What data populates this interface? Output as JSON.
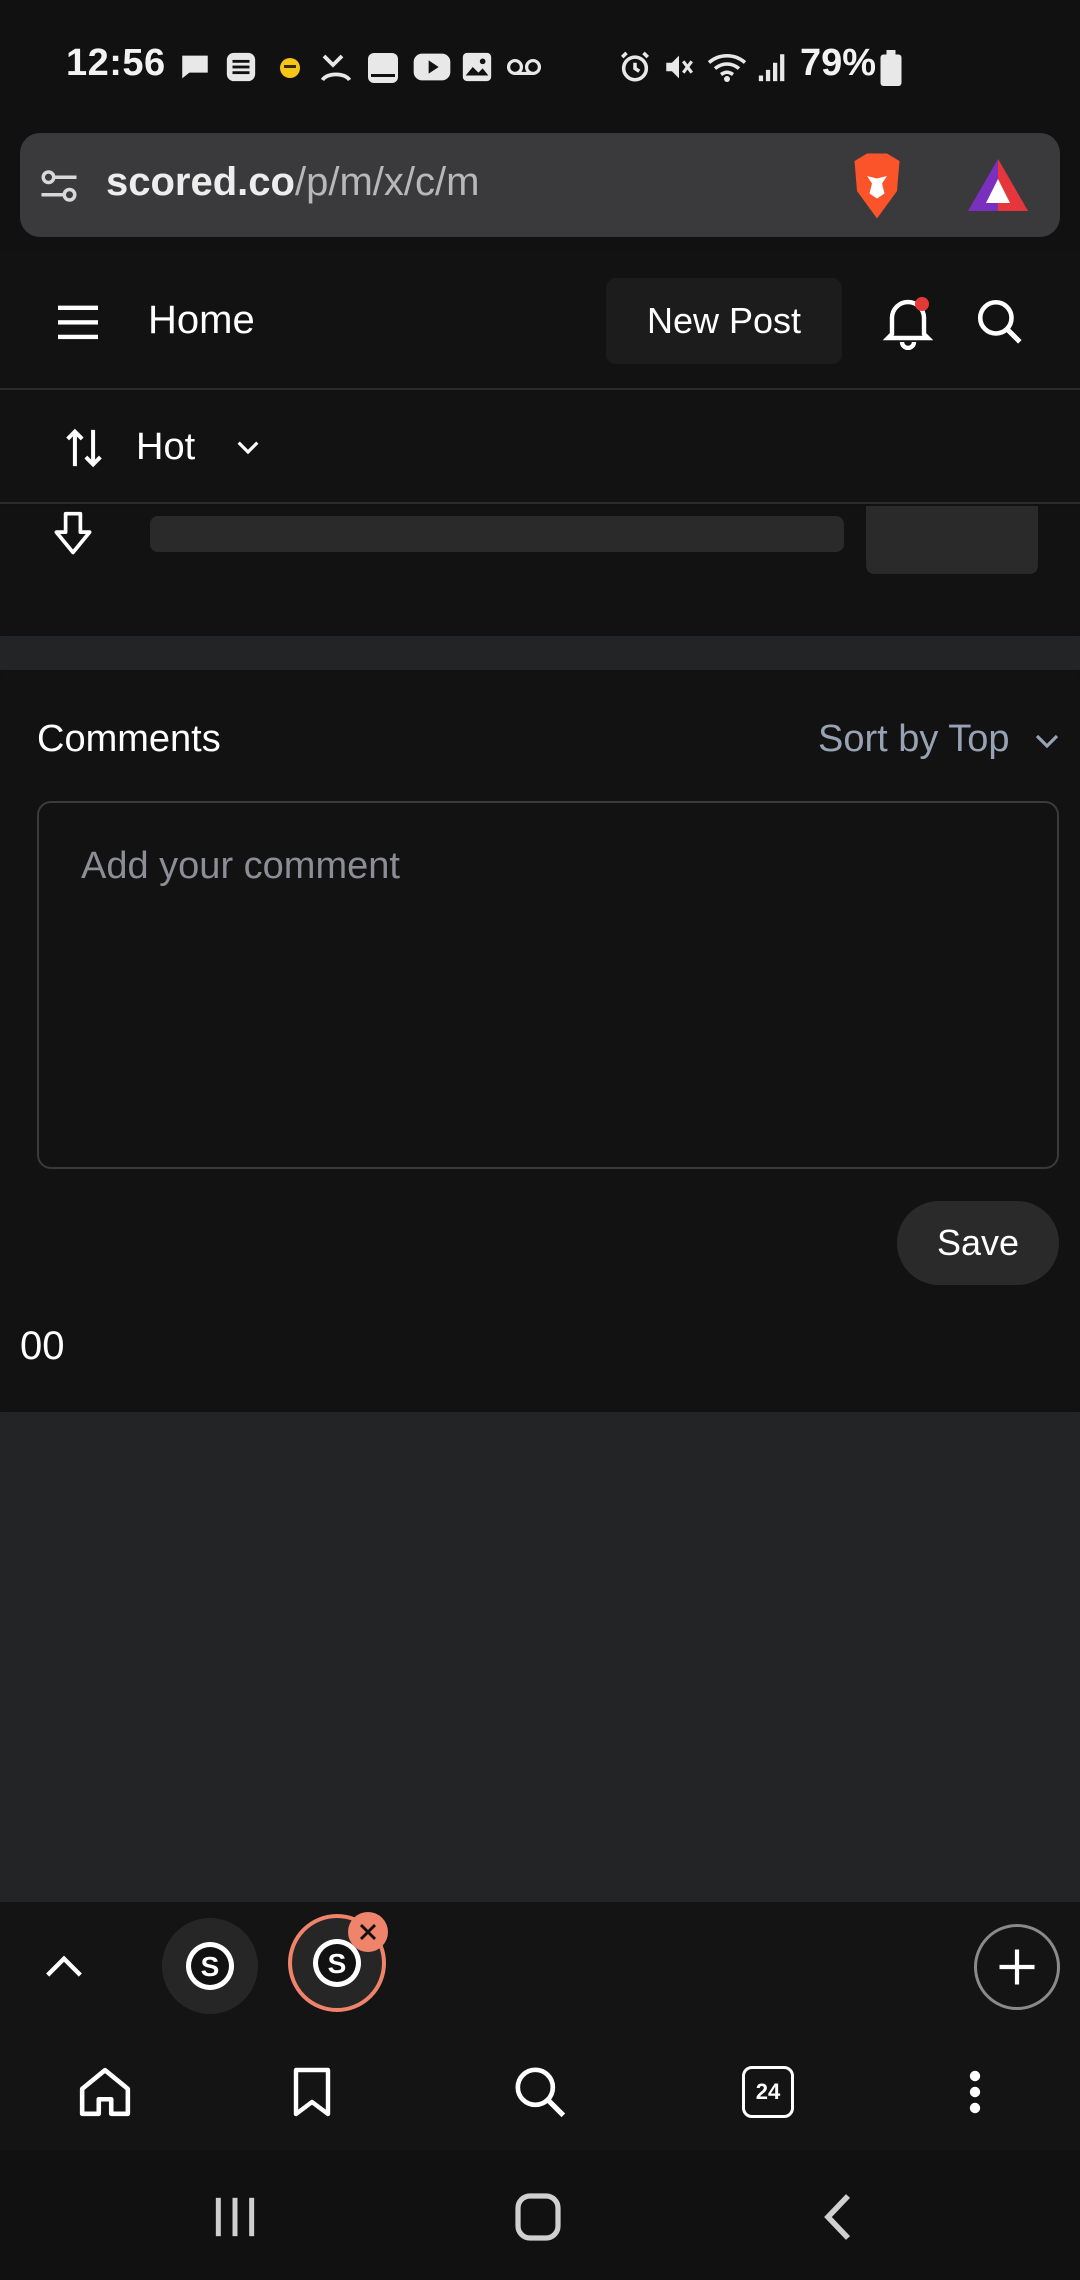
{
  "status_bar": {
    "time": "12:56",
    "battery_percent": "79%",
    "icons": [
      "message-icon",
      "list-icon",
      "emoji-icon",
      "call-forward-icon",
      "tablet-icon",
      "youtube-icon",
      "image-icon",
      "voicemail-icon",
      "alarm-icon",
      "mute-icon",
      "wifi-icon",
      "signal-icon",
      "battery-icon"
    ]
  },
  "browser": {
    "url_host": "scored.co",
    "url_path": "/p/m/x/c/m",
    "tab_count": "24"
  },
  "site_header": {
    "title": "Home",
    "new_post_label": "New Post"
  },
  "sort_bar": {
    "label": "Hot"
  },
  "comments": {
    "heading": "Comments",
    "sort_label": "Sort by Top",
    "placeholder": "Add your comment",
    "save_label": "Save",
    "count": "00"
  },
  "colors": {
    "background": "#111111",
    "surface": "#1c1c1c",
    "muted_text": "#97a3b4",
    "notification_dot": "#e53935",
    "active_tab_ring": "#f0846a",
    "brave_orange": "#fb542b"
  }
}
